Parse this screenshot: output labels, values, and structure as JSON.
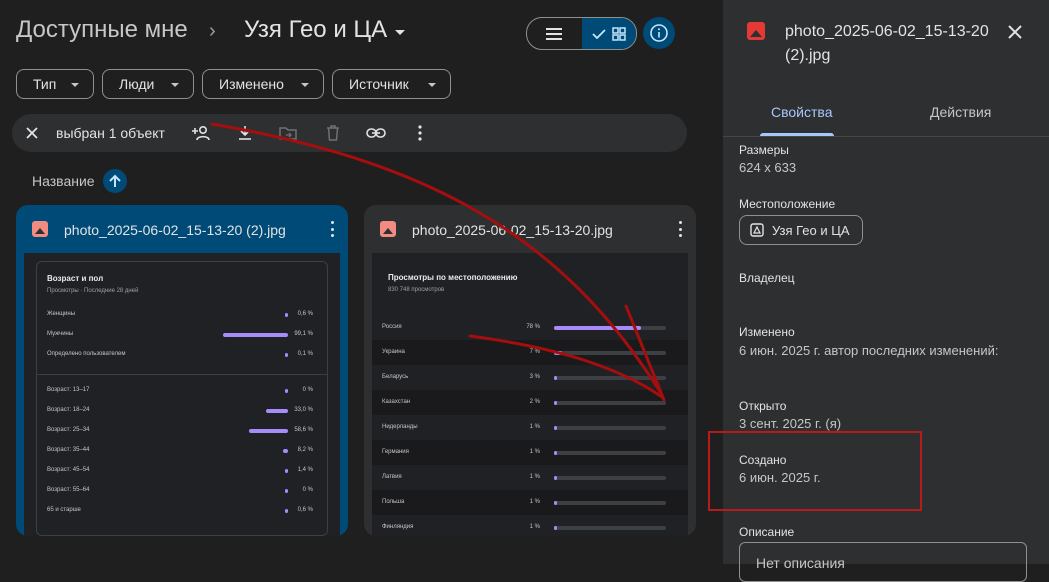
{
  "header": {
    "breadcrumb_root": "Доступные мне",
    "breadcrumb_sep": "›",
    "breadcrumb_current": "Узя Гео и ЦА"
  },
  "filters": [
    "Тип",
    "Люди",
    "Изменено",
    "Источник"
  ],
  "selection": {
    "text": "выбран 1 объект"
  },
  "sort": {
    "label": "Название"
  },
  "files": [
    {
      "name": "photo_2025-06-02_15-13-20 (2).jpg",
      "thumbnail": {
        "title": "Возраст и пол",
        "subtitle": "Просмотры · Последние 28 дней",
        "rows_top": [
          {
            "label": "Женщины",
            "value": 0.6,
            "pct": "0,6 %"
          },
          {
            "label": "Мужчины",
            "value": 99.1,
            "pct": "99,1 %"
          },
          {
            "label": "Определено пользователем",
            "value": 0.1,
            "pct": "0,1 %"
          }
        ],
        "rows_bottom": [
          {
            "label": "Возраст: 13–17",
            "value": 0,
            "pct": "0 %"
          },
          {
            "label": "Возраст: 18–24",
            "value": 33.0,
            "pct": "33,0 %"
          },
          {
            "label": "Возраст: 25–34",
            "value": 58.6,
            "pct": "58,6 %"
          },
          {
            "label": "Возраст: 35–44",
            "value": 8.2,
            "pct": "8,2 %"
          },
          {
            "label": "Возраст: 45–54",
            "value": 1.4,
            "pct": "1,4 %"
          },
          {
            "label": "Возраст: 55–64",
            "value": 0,
            "pct": "0 %"
          },
          {
            "label": "65 и старше",
            "value": 0.6,
            "pct": "0,6 %"
          }
        ]
      }
    },
    {
      "name": "photo_2025-06-02_15-13-20.jpg",
      "thumbnail": {
        "title": "Просмотры по местоположению",
        "subtitle": "830 748 просмотров",
        "rows": [
          {
            "label": "Россия",
            "value": 78,
            "pct": "78 %"
          },
          {
            "label": "Украина",
            "value": 7,
            "pct": "7 %"
          },
          {
            "label": "Беларусь",
            "value": 3,
            "pct": "3 %"
          },
          {
            "label": "Казахстан",
            "value": 2,
            "pct": "2 %"
          },
          {
            "label": "Нидерланды",
            "value": 1,
            "pct": "1 %"
          },
          {
            "label": "Германия",
            "value": 1,
            "pct": "1 %"
          },
          {
            "label": "Латвия",
            "value": 1,
            "pct": "1 %"
          },
          {
            "label": "Польша",
            "value": 1,
            "pct": "1 %"
          },
          {
            "label": "Финляндия",
            "value": 1,
            "pct": "1 %"
          }
        ]
      }
    }
  ],
  "details": {
    "title": "photo_2025-06-02_15-13-20 (2).jpg",
    "tabs": [
      "Свойства",
      "Действия"
    ],
    "size_label": "Размеры",
    "size_value": "624 x 633",
    "location_label": "Местоположение",
    "location_value": "Узя Гео и ЦА",
    "owner_label": "Владелец",
    "modified_label": "Изменено",
    "modified_value": "6 июн. 2025 г. автор последних изменений:",
    "opened_label": "Открыто",
    "opened_value": "3 сент. 2025 г. (я)",
    "created_label": "Создано",
    "created_value": "6 июн. 2025 г.",
    "description_label": "Описание",
    "description_placeholder": "Нет описания"
  },
  "colors": {
    "accent": "#004a77",
    "accent_text": "#a8c7fa",
    "bar_fill": "#a78bfa",
    "annotation": "#b71c1c"
  }
}
